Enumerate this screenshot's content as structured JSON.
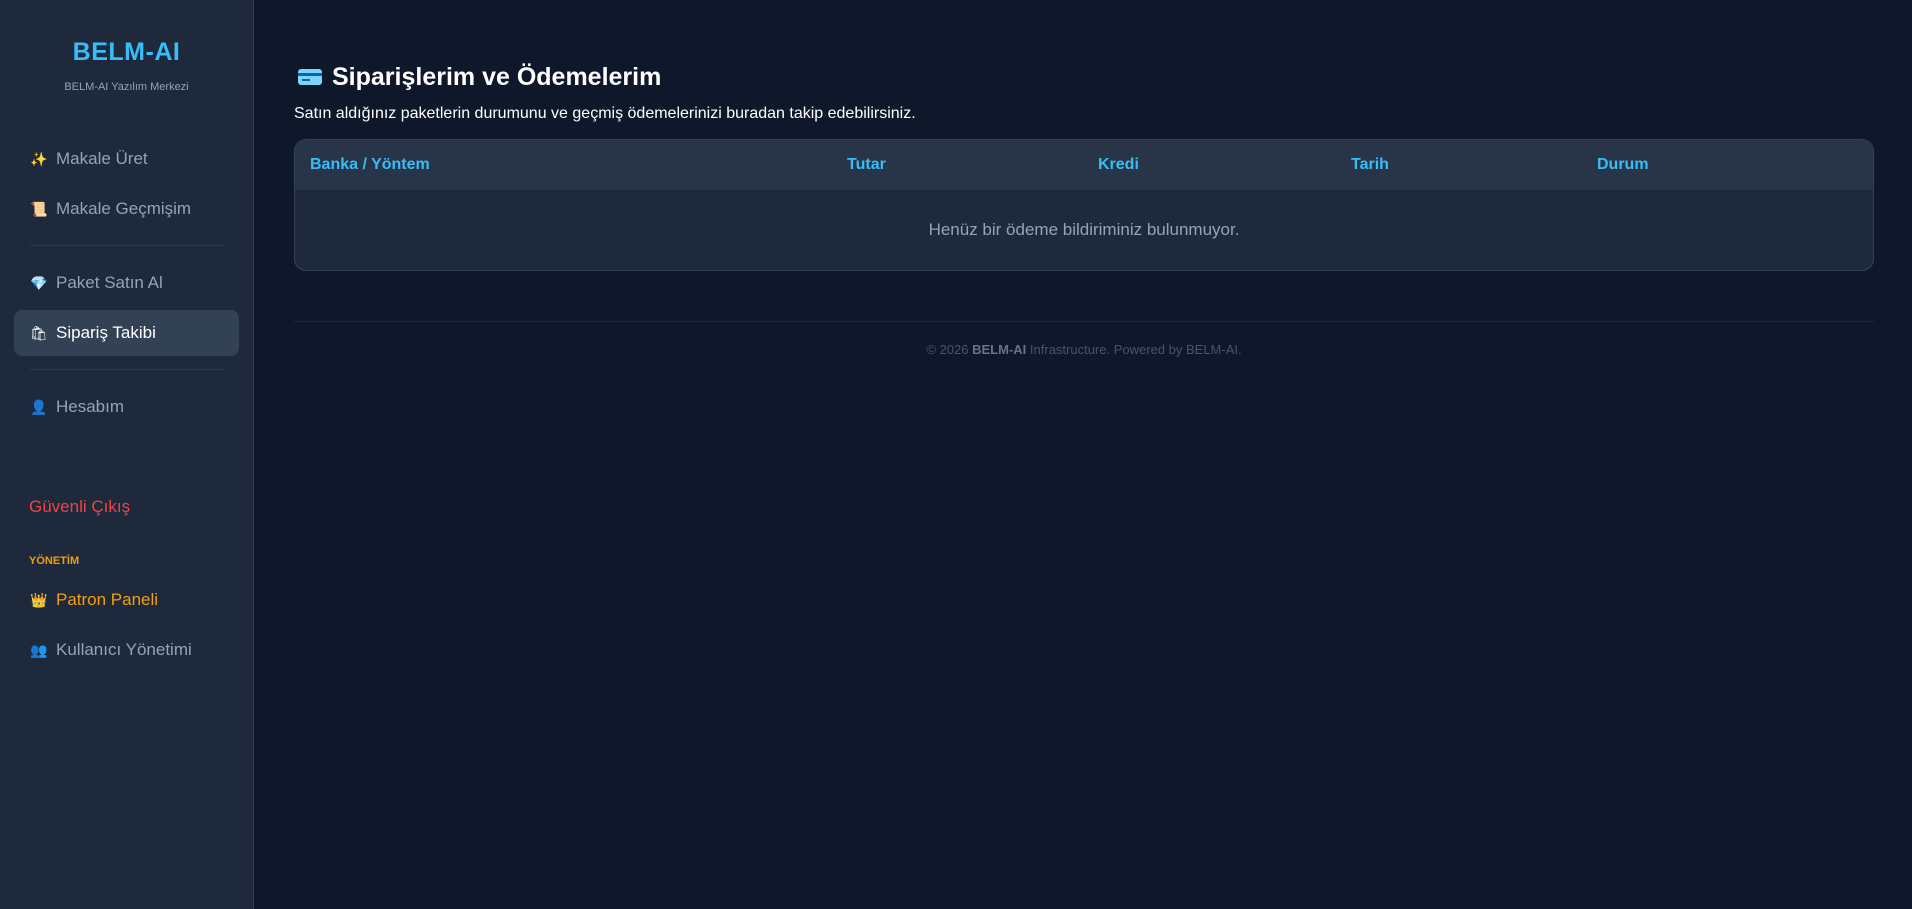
{
  "sidebar": {
    "brand_title": "BELM-AI",
    "brand_subtitle": "BELM-AI Yazılım Merkezi",
    "items_top": [
      {
        "icon": "sparkles-icon",
        "glyph": "✨",
        "label": "Makale Üret"
      },
      {
        "icon": "scroll-icon",
        "glyph": "📜",
        "label": "Makale Geçmişim"
      }
    ],
    "items_mid": [
      {
        "icon": "gem-icon",
        "glyph": "💎",
        "label": "Paket Satın Al"
      },
      {
        "icon": "shopping-bags-icon",
        "glyph": "🛍",
        "label": "Sipariş Takibi"
      }
    ],
    "items_account": [
      {
        "icon": "user-icon",
        "glyph": "👤",
        "label": "Hesabım"
      }
    ],
    "logout_label": "Güvenli Çıkış",
    "admin_section_label": "YÖNETİM",
    "items_admin": [
      {
        "icon": "crown-icon",
        "glyph": "👑",
        "label": "Patron Paneli"
      },
      {
        "icon": "users-icon",
        "glyph": "👥",
        "label": "Kullanıcı Yönetimi"
      }
    ]
  },
  "main": {
    "title": "Siparişlerim ve Ödemelerim",
    "description": "Satın aldığınız paketlerin durumunu ve geçmiş ödemelerinizi buradan takip edebilirsiniz.",
    "table": {
      "columns": [
        "Banka / Yöntem",
        "Tutar",
        "Kredi",
        "Tarih",
        "Durum"
      ],
      "rows": [],
      "empty_message": "Henüz bir ödeme bildiriminiz bulunmuyor."
    },
    "footer": {
      "prefix": "© 2026 ",
      "brand": "BELM-AI",
      "suffix": " Infrastructure. Powered by BELM-AI."
    }
  },
  "colors": {
    "accent": "#38bdf8",
    "background": "#0f172a",
    "sidebar": "#1e293b",
    "danger": "#ef4444",
    "gold": "#f59e0b"
  }
}
